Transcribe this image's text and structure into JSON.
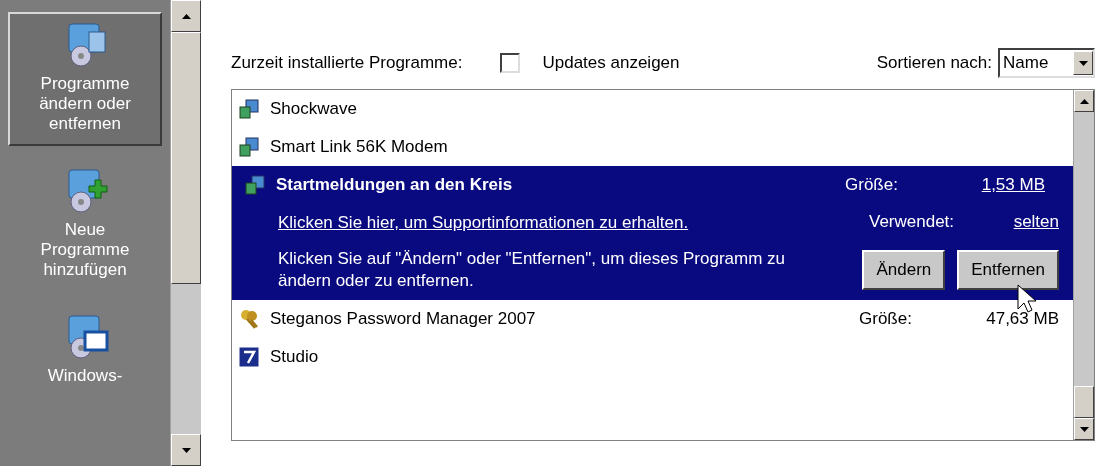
{
  "sidebar": {
    "items": [
      {
        "label": "Programme ändern oder entfernen",
        "selected": true
      },
      {
        "label": "Neue Programme hinzufügen",
        "selected": false
      },
      {
        "label": "Windows-",
        "selected": false
      }
    ]
  },
  "header": {
    "label": "Zurzeit installierte Programme:",
    "updates_checkbox": {
      "label": "Updates anzeigen",
      "checked": false
    },
    "sort": {
      "label": "Sortieren nach:",
      "value": "Name"
    }
  },
  "programs": [
    {
      "name": "Shockwave",
      "selected": false
    },
    {
      "name": "Smart Link 56K Modem",
      "selected": false
    },
    {
      "name": "Startmeldungen an den Kreis",
      "selected": true,
      "size_label": "Größe:",
      "size": "1,53 MB",
      "support_link": "Klicken Sie hier, um Supportinformationen zu erhalten.",
      "used_label": "Verwendet:",
      "used": "selten",
      "message": "Klicken Sie auf \"Ändern\" oder \"Entfernen\", um dieses Programm zu ändern oder zu entfernen.",
      "buttons": [
        "Ändern",
        "Entfernen"
      ]
    },
    {
      "name": "Steganos Password Manager 2007",
      "selected": false,
      "size_label": "Größe:",
      "size": "47,63 MB"
    },
    {
      "name": "Studio",
      "selected": false
    }
  ]
}
